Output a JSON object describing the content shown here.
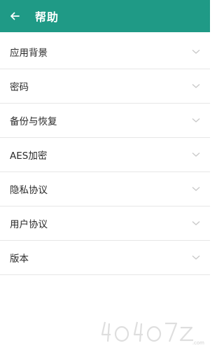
{
  "header": {
    "title": "帮助",
    "back_icon": "arrow-left-icon"
  },
  "colors": {
    "header_bg": "#1f9a86",
    "header_text": "#ffffff",
    "divider": "#e7e7e7",
    "chevron": "#c8c8c8"
  },
  "items": [
    {
      "label": "应用背景"
    },
    {
      "label": "密码"
    },
    {
      "label": "备份与恢复"
    },
    {
      "label": "AES加密"
    },
    {
      "label": "隐私协议"
    },
    {
      "label": "用户协议"
    },
    {
      "label": "版本"
    }
  ],
  "watermark": {
    "text": "4o4o7.com"
  }
}
